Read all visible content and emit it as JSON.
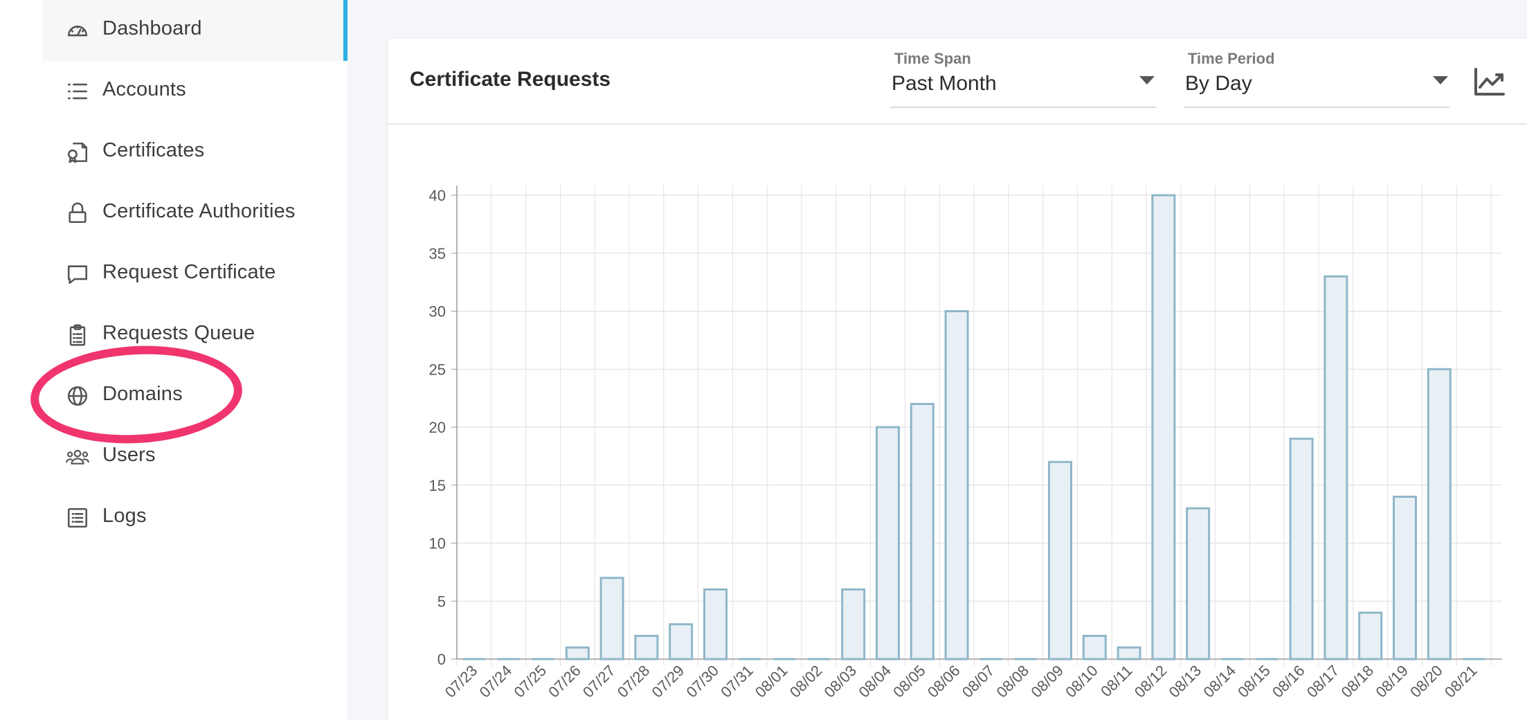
{
  "sidebar": {
    "items": [
      {
        "label": "Dashboard",
        "icon": "gauge-icon",
        "active": true
      },
      {
        "label": "Accounts",
        "icon": "list-icon",
        "active": false
      },
      {
        "label": "Certificates",
        "icon": "certificate-icon",
        "active": false
      },
      {
        "label": "Certificate Authorities",
        "icon": "lock-icon",
        "active": false
      },
      {
        "label": "Request Certificate",
        "icon": "speech-bubble-icon",
        "active": false
      },
      {
        "label": "Requests Queue",
        "icon": "clipboard-icon",
        "active": false
      },
      {
        "label": "Domains",
        "icon": "globe-icon",
        "active": false
      },
      {
        "label": "Users",
        "icon": "users-icon",
        "active": false
      },
      {
        "label": "Logs",
        "icon": "log-list-icon",
        "active": false
      }
    ],
    "active_color": "#2bb3e6",
    "highlight_color": "#f0356e"
  },
  "card": {
    "title": "Certificate Requests",
    "time_span": {
      "label": "Time Span",
      "value": "Past Month"
    },
    "time_period": {
      "label": "Time Period",
      "value": "By Day"
    },
    "chart_toggle_icon": "line-chart-icon"
  },
  "chart_data": {
    "type": "bar",
    "categories": [
      "07/23",
      "07/24",
      "07/25",
      "07/26",
      "07/27",
      "07/28",
      "07/29",
      "07/30",
      "07/31",
      "08/01",
      "08/02",
      "08/03",
      "08/04",
      "08/05",
      "08/06",
      "08/07",
      "08/08",
      "08/09",
      "08/10",
      "08/11",
      "08/12",
      "08/13",
      "08/14",
      "08/15",
      "08/16",
      "08/17",
      "08/18",
      "08/19",
      "08/20",
      "08/21"
    ],
    "values": [
      0,
      0,
      0,
      1,
      7,
      2,
      3,
      6,
      0,
      0,
      0,
      6,
      20,
      22,
      30,
      0,
      0,
      17,
      2,
      1,
      40,
      13,
      0,
      0,
      19,
      33,
      4,
      14,
      25,
      0
    ],
    "ylim": [
      0,
      40
    ],
    "yticks": [
      0,
      5,
      10,
      15,
      20,
      25,
      30,
      35,
      40
    ],
    "grid": true,
    "bar_fill": "#e8f0f5",
    "bar_stroke": "#8fb6c9"
  }
}
